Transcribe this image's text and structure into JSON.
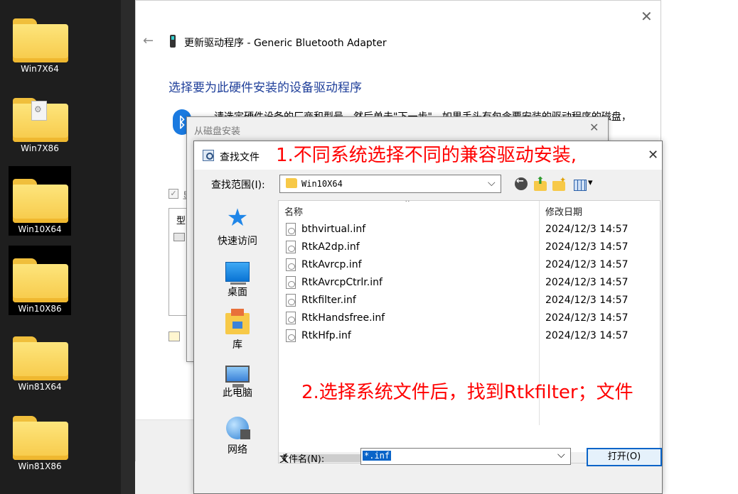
{
  "desktop": {
    "folders": [
      {
        "label": "Win7X64",
        "selected": false
      },
      {
        "label": "Win7X86",
        "selected": false
      },
      {
        "label": "Win10X64",
        "selected": true
      },
      {
        "label": "Win10X86",
        "selected": true
      },
      {
        "label": "Win81X64",
        "selected": false
      },
      {
        "label": "Win81X86",
        "selected": false
      }
    ]
  },
  "wizard": {
    "title": "更新驱动程序 - Generic Bluetooth Adapter",
    "heading": "选择要为此硬件安装的设备驱动程序",
    "body": "请选定硬件设备的厂商和型号，然后单击\"下一步\"。如果手头有包含要安装的驱动程序的磁盘，",
    "check_label": "显",
    "list_header": "型",
    "bluetooth_glyph": "ᛒ",
    "close_glyph": "✕",
    "back_glyph": "←"
  },
  "disk_dialog": {
    "title": "从磁盘安装",
    "close_glyph": "✕"
  },
  "find_dialog": {
    "title": "查找文件",
    "close_glyph": "✕",
    "look_in_label": "查找范围(I):",
    "look_in_value": "Win10X64",
    "places": [
      "快速访问",
      "桌面",
      "库",
      "此电脑",
      "网络"
    ],
    "columns": {
      "name": "名称",
      "modified": "修改日期"
    },
    "files": [
      {
        "name": "bthvirtual.inf",
        "modified": "2024/12/3 14:57"
      },
      {
        "name": "RtkA2dp.inf",
        "modified": "2024/12/3 14:57"
      },
      {
        "name": "RtkAvrcp.inf",
        "modified": "2024/12/3 14:57"
      },
      {
        "name": "RtkAvrcpCtrlr.inf",
        "modified": "2024/12/3 14:57"
      },
      {
        "name": "Rtkfilter.inf",
        "modified": "2024/12/3 14:57"
      },
      {
        "name": "RtkHandsfree.inf",
        "modified": "2024/12/3 14:57"
      },
      {
        "name": "RtkHfp.inf",
        "modified": "2024/12/3 14:57"
      }
    ],
    "file_name_label": "文件名(N):",
    "file_name_value": "*.inf",
    "open_button": "打开(O)"
  },
  "annotations": [
    "1.不同系统选择不同的兼容驱动安装,",
    "2.选择系统文件后，找到Rtkfilter；文件"
  ]
}
